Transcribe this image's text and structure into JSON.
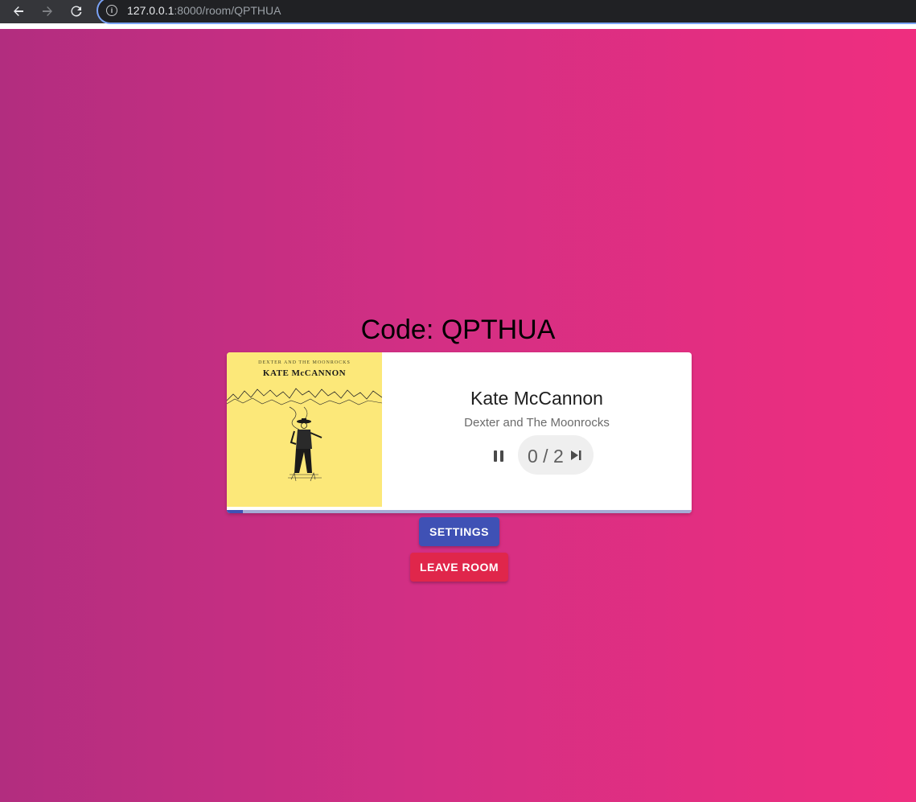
{
  "browser": {
    "url_host": "127.0.0.1",
    "url_path": ":8000/room/QPTHUA",
    "back_icon": "arrow-left-icon",
    "forward_icon": "arrow-right-icon",
    "reload_icon": "reload-icon",
    "info_icon": "info-icon"
  },
  "room": {
    "code_label": "Code: QPTHUA"
  },
  "player": {
    "album_band": "DEXTER AND THE MOONROCKS",
    "album_title": "KATE McCANNON",
    "title": "Kate McCannon",
    "artist": "Dexter and The Moonrocks",
    "votes": "0 / 2",
    "is_playing": true,
    "progress_fraction": 0.035,
    "pause_icon": "pause-icon",
    "skip_icon": "skip-next-icon"
  },
  "actions": {
    "settings_label": "SETTINGS",
    "leave_label": "LEAVE ROOM"
  },
  "colors": {
    "primary": "#3f51b5",
    "secondary": "#e0264b",
    "background_start": "#b22d7f",
    "background_end": "#ef2e7f",
    "album_bg": "#fce879"
  }
}
